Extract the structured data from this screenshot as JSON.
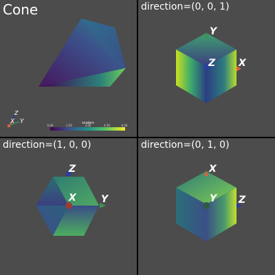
{
  "viewports": [
    {
      "title": "Cone",
      "axes_labels": [
        "X",
        "Y",
        "Z"
      ],
      "scalar_bar": {
        "title": "scalars",
        "ticks": [
          "0.00",
          "1.50",
          "3.00",
          "4.50",
          "6.00"
        ]
      }
    },
    {
      "title": "direction=(0, 0, 1)",
      "axes_labels": [
        "Y",
        "Z",
        "X"
      ]
    },
    {
      "title": "direction=(1, 0, 0)",
      "axes_labels": [
        "Z",
        "X",
        "Y"
      ]
    },
    {
      "title": "direction=(0, 1, 0)",
      "axes_labels": [
        "X",
        "Y",
        "Z"
      ]
    }
  ],
  "colors": {
    "background": "#4c4c4c",
    "separator": "#000000",
    "axis_x": "#e0603f",
    "axis_y": "#3f8f5a",
    "axis_z": "#2a3fa0",
    "colormap": [
      "#440154",
      "#3b528b",
      "#21918c",
      "#5ec962",
      "#fde725"
    ]
  }
}
